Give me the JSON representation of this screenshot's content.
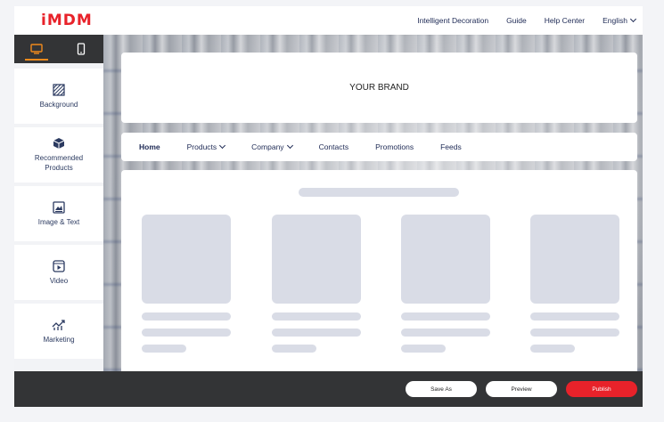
{
  "brand": {
    "logo_text": "iMDM",
    "logo_color": "#e8222a"
  },
  "top_nav": {
    "items": [
      "Intelligent Decoration",
      "Guide",
      "Help Center"
    ],
    "language": "English"
  },
  "sidebar": {
    "devices": [
      {
        "icon": "desktop-icon",
        "active": true
      },
      {
        "icon": "mobile-icon",
        "active": false
      }
    ],
    "items": [
      {
        "icon": "background-icon",
        "label": "Background"
      },
      {
        "icon": "product-box-icon",
        "label": "Recommended Products"
      },
      {
        "icon": "image-text-icon",
        "label": "Image & Text"
      },
      {
        "icon": "video-icon",
        "label": "Video"
      },
      {
        "icon": "marketing-chart-icon",
        "label": "Marketing"
      }
    ]
  },
  "canvas": {
    "brand_text": "YOUR BRAND",
    "menu": [
      "Home",
      "Products",
      "Company",
      "Contacts",
      "Promotions",
      "Feeds"
    ]
  },
  "actions": {
    "save_as": "Save As",
    "preview": "Preview",
    "publish": "Publish"
  },
  "colors": {
    "accent_orange": "#f08a1c",
    "dark_bar": "#333436",
    "placeholder": "#d9dce6"
  }
}
